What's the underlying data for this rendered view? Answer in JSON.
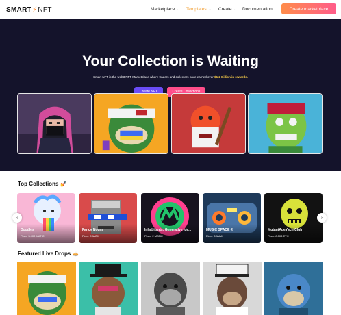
{
  "header": {
    "logo_brand": "SMART",
    "logo_bolt": "⚡",
    "logo_suffix": "NFT",
    "nav": [
      {
        "label": "Marketplace",
        "has_dropdown": true,
        "active": false
      },
      {
        "label": "Templates",
        "has_dropdown": true,
        "active": true
      },
      {
        "label": "Create",
        "has_dropdown": true,
        "active": false
      },
      {
        "label": "Documentation",
        "has_dropdown": false,
        "active": false
      }
    ],
    "cta": "Create marketplace",
    "chevron": "⌄"
  },
  "hero": {
    "title": "Your Collection is Waiting",
    "subtitle_pre": "Smart NFT is the web3 NFT Marketplace where traders and collectors have earned over ",
    "subtitle_highlight": "$1.2 Billion in rewards.",
    "btn_create_nft": "Create NFT",
    "btn_create_collection": "Create Collections",
    "cards": [
      "hero-art-hooded-girl",
      "hero-art-bandana-ape",
      "hero-art-red-creature",
      "hero-art-green-zombie-ape"
    ]
  },
  "top_collections": {
    "title": "Top Collections",
    "emoji": "💅",
    "items": [
      {
        "name": "Doodles",
        "floor": "Floor: 3.000 MATIC"
      },
      {
        "name": "Fancy Nouns",
        "floor": "Floor: 9 AVAX"
      },
      {
        "name": "Inhabitants: Generative Ide...",
        "floor": "Floor: 2 MATIC"
      },
      {
        "name": "MUSIC SPACE ®",
        "floor": "Floor: 6 AVAX"
      },
      {
        "name": "MutantApeYachtClub",
        "floor": "Floor: 8.003 ETH"
      }
    ],
    "prev_arrow": "‹",
    "next_arrow": "›"
  },
  "featured_drops": {
    "title": "Featured Live Drops",
    "emoji": "🥧"
  },
  "colors": {
    "hero_bg": "#14132b",
    "accent_orange": "#ff8c4a",
    "accent_pink": "#ff4d8a",
    "accent_purple": "#6a4cf6",
    "nav_active": "#f2a23a"
  }
}
